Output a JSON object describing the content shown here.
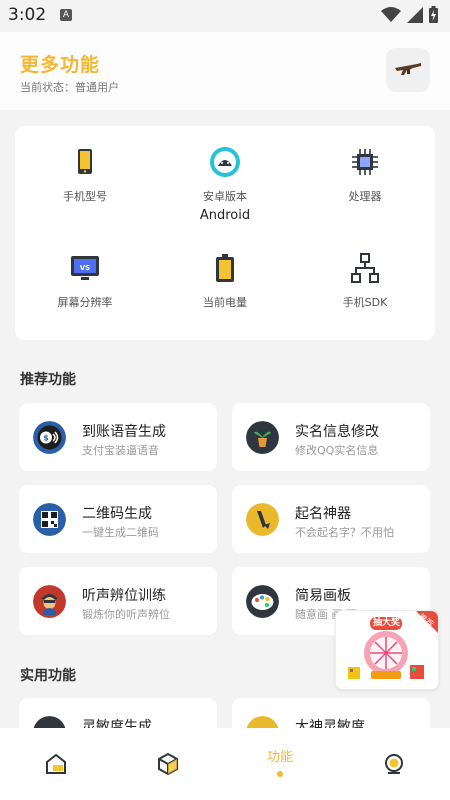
{
  "status": {
    "time": "3:02",
    "badge": "A"
  },
  "header": {
    "title": "更多功能",
    "subtitle": "当前状态：普通用户"
  },
  "device_info": [
    {
      "label": "手机型号",
      "value": "",
      "icon": "phone-icon"
    },
    {
      "label": "安卓版本",
      "value": "Android",
      "icon": "android-icon"
    },
    {
      "label": "处理器",
      "value": "",
      "icon": "cpu-icon"
    },
    {
      "label": "屏幕分辨率",
      "value": "",
      "icon": "screen-icon"
    },
    {
      "label": "当前电量",
      "value": "",
      "icon": "battery-icon"
    },
    {
      "label": "手机SDK",
      "value": "",
      "icon": "sdk-icon"
    }
  ],
  "sections": {
    "recommended": "推荐功能",
    "utility": "实用功能"
  },
  "features": [
    {
      "name": "到账语音生成",
      "desc": "支付宝装逼语音",
      "icon": "payment-voice-icon",
      "color": "#2a5fa8"
    },
    {
      "name": "实名信息修改",
      "desc": "修改QQ实名信息",
      "icon": "plant-icon",
      "color": "#2f3640"
    },
    {
      "name": "二维码生成",
      "desc": "一键生成二维码",
      "icon": "qrcode-icon",
      "color": "#2a5fa8"
    },
    {
      "name": "起名神器",
      "desc": "不会起名字？不用怕",
      "icon": "pen-icon",
      "color": "#e9b92b"
    },
    {
      "name": "听声辨位训练",
      "desc": "锻炼你的听声辨位",
      "icon": "soldier-icon",
      "color": "#c0392b"
    },
    {
      "name": "简易画板",
      "desc": "随意画 画 画",
      "icon": "palette-icon",
      "color": "#2f3640"
    },
    {
      "name": "灵敏度生成",
      "desc": "",
      "icon": "sensitivity-icon",
      "color": "#2f3640"
    },
    {
      "name": "大神灵敏度",
      "desc": "",
      "icon": "master-icon",
      "color": "#e9b92b"
    }
  ],
  "lottery": {
    "label": "抽大奖",
    "badge": "推荐"
  },
  "nav": {
    "home": "",
    "box": "",
    "function": "功能",
    "profile": ""
  }
}
